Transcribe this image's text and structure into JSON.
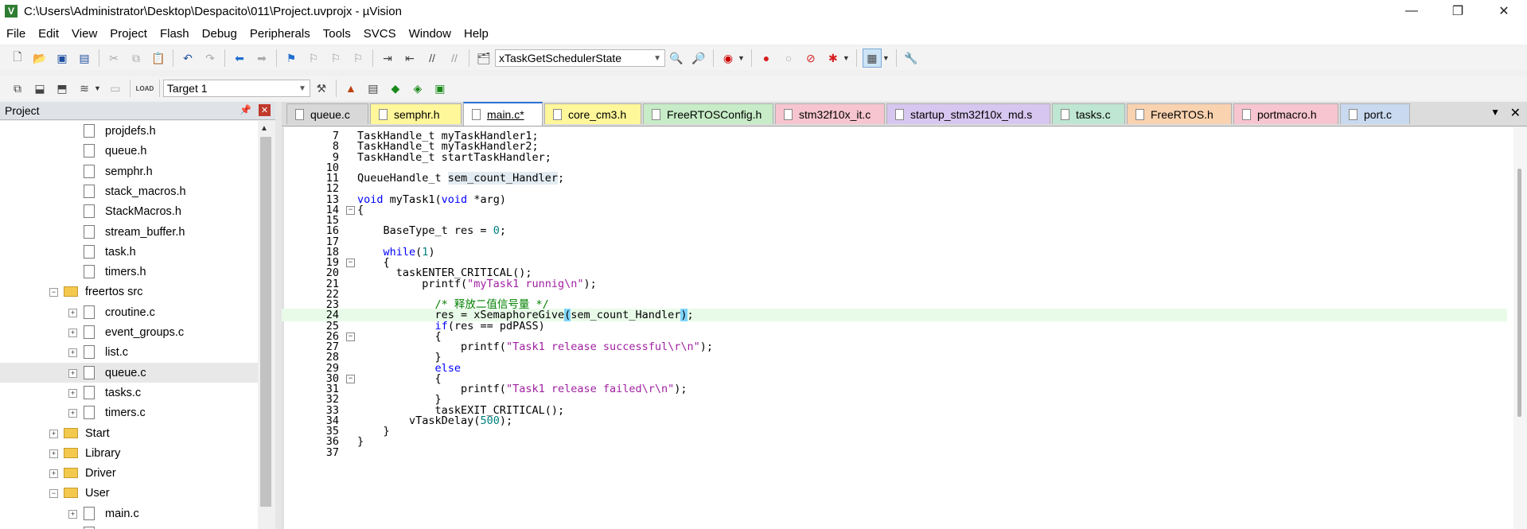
{
  "window": {
    "title": "C:\\Users\\Administrator\\Desktop\\Despacito\\011\\Project.uvprojx - µVision",
    "minimize": "—",
    "maximize": "❐",
    "close": "✕"
  },
  "menu": [
    "File",
    "Edit",
    "View",
    "Project",
    "Flash",
    "Debug",
    "Peripherals",
    "Tools",
    "SVCS",
    "Window",
    "Help"
  ],
  "toolbar": {
    "find_combo": "xTaskGetSchedulerState",
    "target_combo": "Target 1"
  },
  "project_panel": {
    "title": "Project",
    "tree": [
      {
        "label": "projdefs.h",
        "type": "file",
        "level": 2
      },
      {
        "label": "queue.h",
        "type": "file",
        "level": 2
      },
      {
        "label": "semphr.h",
        "type": "file",
        "level": 2
      },
      {
        "label": "stack_macros.h",
        "type": "file",
        "level": 2
      },
      {
        "label": "StackMacros.h",
        "type": "file",
        "level": 2
      },
      {
        "label": "stream_buffer.h",
        "type": "file",
        "level": 2
      },
      {
        "label": "task.h",
        "type": "file",
        "level": 2
      },
      {
        "label": "timers.h",
        "type": "file",
        "level": 2
      },
      {
        "label": "freertos src",
        "type": "folder",
        "level": 1,
        "expanded": true
      },
      {
        "label": "croutine.c",
        "type": "file",
        "level": 2,
        "expander": true
      },
      {
        "label": "event_groups.c",
        "type": "file",
        "level": 2,
        "expander": true
      },
      {
        "label": "list.c",
        "type": "file",
        "level": 2,
        "expander": true
      },
      {
        "label": "queue.c",
        "type": "file",
        "level": 2,
        "expander": true,
        "selected": true
      },
      {
        "label": "tasks.c",
        "type": "file",
        "level": 2,
        "expander": true
      },
      {
        "label": "timers.c",
        "type": "file",
        "level": 2,
        "expander": true
      },
      {
        "label": "Start",
        "type": "folder",
        "level": 1,
        "expanded": false
      },
      {
        "label": "Library",
        "type": "folder",
        "level": 1,
        "expanded": false
      },
      {
        "label": "Driver",
        "type": "folder",
        "level": 1,
        "expanded": false
      },
      {
        "label": "User",
        "type": "folder",
        "level": 1,
        "expanded": true
      },
      {
        "label": "main.c",
        "type": "file",
        "level": 2,
        "expander": true
      }
    ]
  },
  "tabs": [
    {
      "label": "queue.c",
      "color": "#d8d8d8",
      "active": false
    },
    {
      "label": "semphr.h",
      "color": "#fff79a",
      "active": false
    },
    {
      "label": "main.c*",
      "color": "#ffffff",
      "active": true
    },
    {
      "label": "core_cm3.h",
      "color": "#fff79a",
      "active": false
    },
    {
      "label": "FreeRTOSConfig.h",
      "color": "#c7ecc7",
      "active": false
    },
    {
      "label": "stm32f10x_it.c",
      "color": "#f7c5cf",
      "active": false
    },
    {
      "label": "startup_stm32f10x_md.s",
      "color": "#d7c6ef",
      "active": false
    },
    {
      "label": "tasks.c",
      "color": "#bfe6d2",
      "active": false
    },
    {
      "label": "FreeRTOS.h",
      "color": "#f9d2b0",
      "active": false
    },
    {
      "label": "portmacro.h",
      "color": "#f7c5cf",
      "active": false
    },
    {
      "label": "port.c",
      "color": "#c9d9ef",
      "active": false
    }
  ],
  "code": {
    "current_line": 24,
    "lines": [
      {
        "n": 7,
        "text": "TaskHandle_t myTaskHandler1;"
      },
      {
        "n": 8,
        "text": "TaskHandle_t myTaskHandler2;"
      },
      {
        "n": 9,
        "text": "TaskHandle_t startTaskHandler;"
      },
      {
        "n": 10,
        "text": ""
      },
      {
        "n": 11,
        "text": "QueueHandle_t sem_count_Handler;"
      },
      {
        "n": 12,
        "text": ""
      },
      {
        "n": 13,
        "text": "void myTask1(void *arg)"
      },
      {
        "n": 14,
        "text": "{"
      },
      {
        "n": 15,
        "text": ""
      },
      {
        "n": 16,
        "text": "    BaseType_t res = 0;"
      },
      {
        "n": 17,
        "text": ""
      },
      {
        "n": 18,
        "text": "    while(1)"
      },
      {
        "n": 19,
        "text": "    {"
      },
      {
        "n": 20,
        "text": "      taskENTER_CRITICAL();"
      },
      {
        "n": 21,
        "text": "          printf(\"myTask1 runnig\\n\");"
      },
      {
        "n": 22,
        "text": ""
      },
      {
        "n": 23,
        "text": "            /* 释放二值信号量 */"
      },
      {
        "n": 24,
        "text": "            res = xSemaphoreGive(sem_count_Handler);"
      },
      {
        "n": 25,
        "text": "            if(res == pdPASS)"
      },
      {
        "n": 26,
        "text": "            {"
      },
      {
        "n": 27,
        "text": "                printf(\"Task1 release successful\\r\\n\");"
      },
      {
        "n": 28,
        "text": "            }"
      },
      {
        "n": 29,
        "text": "            else"
      },
      {
        "n": 30,
        "text": "            {"
      },
      {
        "n": 31,
        "text": "                printf(\"Task1 release failed\\r\\n\");"
      },
      {
        "n": 32,
        "text": "            }"
      },
      {
        "n": 33,
        "text": "            taskEXIT_CRITICAL();"
      },
      {
        "n": 34,
        "text": "        vTaskDelay(500);"
      },
      {
        "n": 35,
        "text": "    }"
      },
      {
        "n": 36,
        "text": "}"
      },
      {
        "n": 37,
        "text": ""
      }
    ]
  }
}
